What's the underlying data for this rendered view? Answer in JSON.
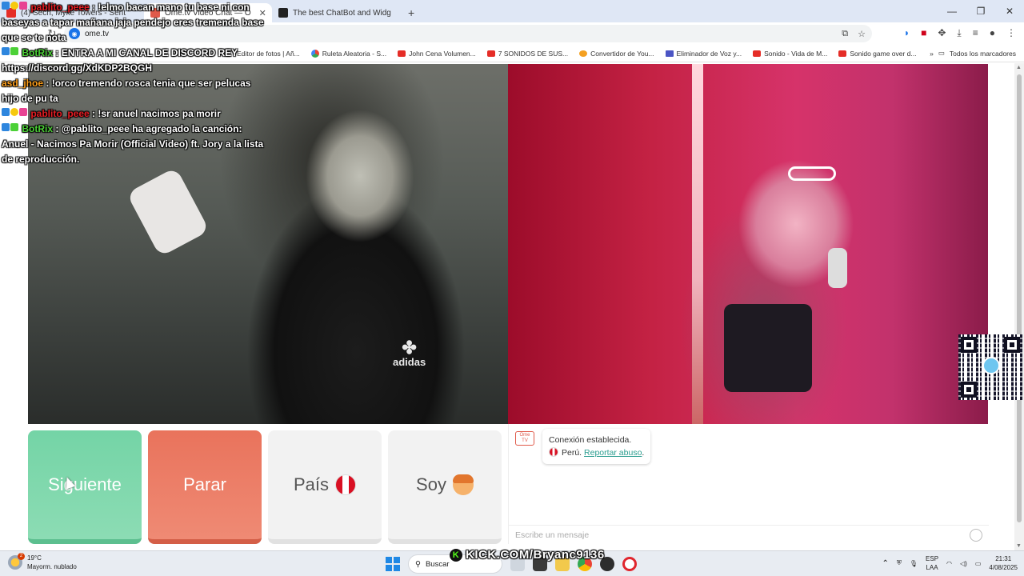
{
  "browser": {
    "tabs": [
      {
        "title": "(4) Sech, Myke Towers - Sent",
        "color": "#e52d27"
      },
      {
        "title": "Ome.tv Video Chat — O",
        "color": "#e05a4a"
      },
      {
        "title": "The best ChatBot and Widg",
        "color": "#222222"
      }
    ],
    "new_tab": "+",
    "url": "ome.tv",
    "bookmarks": [
      {
        "label": "Editor de fotos | Añ...",
        "icon": "photo"
      },
      {
        "label": "Ruleta Aleatoria - S...",
        "icon": "multi"
      },
      {
        "label": "John Cena Volumen...",
        "icon": "youtube"
      },
      {
        "label": "7 SONIDOS DE SUS...",
        "icon": "youtube"
      },
      {
        "label": "Convertidor de You...",
        "icon": "orange"
      },
      {
        "label": "Eliminador de Voz y...",
        "icon": "blue"
      },
      {
        "label": "Sonido - Vida de M...",
        "icon": "youtube"
      },
      {
        "label": "Sonido game over d...",
        "icon": "youtube"
      }
    ],
    "all_bookmarks": "Todos los marcadores"
  },
  "overlay_chat": [
    {
      "user": "pablito_peee",
      "user_color": "red",
      "text": ": !elmo bacan mano tu base ni con baseyas a tapar mañana jaja pendejo eres tremenda base que se te nota"
    },
    {
      "user": "BotRix",
      "user_color": "green",
      "text": ": ENTRA A MI CANAL DE DISCORD REY https://discord.gg/XdKDP2BQGH"
    },
    {
      "user": "asd_jhoe",
      "user_color": "orange",
      "text": ": !orco tremendo rosca tenia que ser pelucas hijo de pu ta"
    },
    {
      "user": "pablito_peee",
      "user_color": "red",
      "text": ": !sr anuel nacimos pa morir"
    },
    {
      "user": "BotRix",
      "user_color": "green",
      "text": ": @pablito_peee ha agregado la canción: Anuel - Nacimos Pa Morir (Official Video) ft. Jory a la lista de reproducción."
    }
  ],
  "video": {
    "left_logo": "adidas"
  },
  "controls": {
    "next": "Siguiente",
    "stop": "Parar",
    "country": "País",
    "gender": "Soy"
  },
  "chat": {
    "logo_text": "Ome TV",
    "status": "Conexión establecida.",
    "country": "Perú.",
    "report": "Reportar abuso",
    "report_suffix": ".",
    "input_placeholder": "Escribe un mensaje"
  },
  "taskbar": {
    "weather_temp": "19°C",
    "weather_desc": "Mayorm. nublado",
    "weather_badge": "2",
    "search": "Buscar",
    "kick": "KICK.COM/Bryanc9136",
    "lang_top": "ESP",
    "lang_bottom": "LAA",
    "time": "21:31",
    "date": "4/08/2025"
  },
  "colors": {
    "next_btn": "#74d4a6",
    "stop_btn": "#e9735c",
    "neutral_btn": "#f2f2f2",
    "link": "#2a9d8f"
  }
}
